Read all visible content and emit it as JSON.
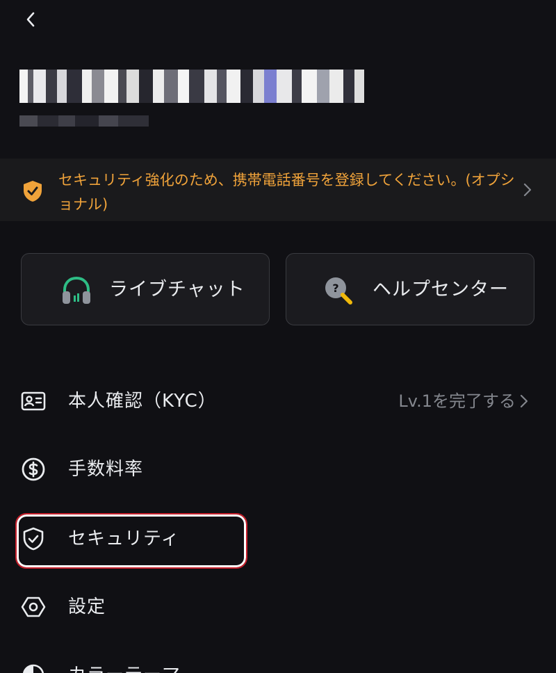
{
  "header": {
    "back_icon": "chevron-left-icon"
  },
  "account": {
    "email_redacted": true,
    "uid_redacted": true
  },
  "banner": {
    "icon": "shield-warning-icon",
    "text": "セキュリティ強化のため、携帯電話番号を登録してください。(オプショナル)",
    "color": "#f0a33a"
  },
  "quick_actions": {
    "live_chat": {
      "label": "ライブチャット",
      "icon": "headset-icon"
    },
    "help_center": {
      "label": "ヘルプセンター",
      "icon": "help-magnifier-icon"
    }
  },
  "menu": {
    "kyc": {
      "label": "本人確認（KYC）",
      "value": "Lv.1を完了する",
      "icon": "id-card-icon"
    },
    "fees": {
      "label": "手数料率",
      "icon": "dollar-circle-icon"
    },
    "security": {
      "label": "セキュリティ",
      "icon": "shield-check-icon"
    },
    "settings": {
      "label": "設定",
      "icon": "hexagon-settings-icon"
    },
    "theme": {
      "label": "カラーテーマ",
      "icon": "theme-icon"
    }
  },
  "colors": {
    "background": "#101014",
    "card": "#1b1b1f",
    "accent_orange": "#f0a33a",
    "accent_green": "#2ebd85",
    "highlight_red": "#c61f2b"
  }
}
